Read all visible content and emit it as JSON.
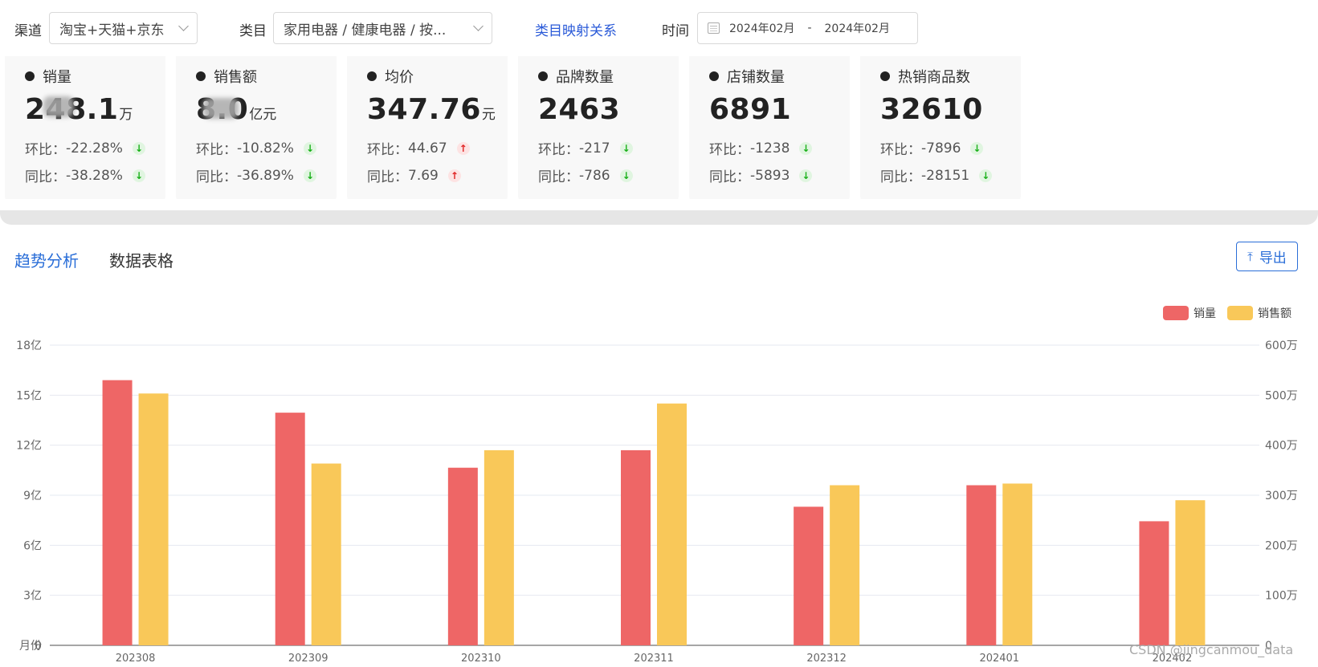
{
  "filters": {
    "channel_label": "渠道",
    "channel_value": "淘宝+天猫+京东",
    "category_label": "类目",
    "category_value": "家用电器 / 健康电器 / 按...",
    "mapping_link": "类目映射关系",
    "time_label": "时间",
    "date_start": "2024年02月",
    "date_sep": "-",
    "date_end": "2024年02月"
  },
  "kpis": [
    {
      "title": "销量",
      "value": "248.1",
      "unit": "万",
      "mom_label": "环比：",
      "mom": "-22.28%",
      "mom_dir": "down",
      "yoy_label": "同比：",
      "yoy": "-38.28%",
      "yoy_dir": "down"
    },
    {
      "title": "销售额",
      "value": "8.0",
      "unit": "亿元",
      "mom_label": "环比：",
      "mom": "-10.82%",
      "mom_dir": "down",
      "yoy_label": "同比：",
      "yoy": "-36.89%",
      "yoy_dir": "down"
    },
    {
      "title": "均价",
      "value": "347.76",
      "unit": "元",
      "mom_label": "环比：",
      "mom": "44.67",
      "mom_dir": "up",
      "yoy_label": "同比：",
      "yoy": "7.69",
      "yoy_dir": "up"
    },
    {
      "title": "品牌数量",
      "value": "2463",
      "unit": "",
      "mom_label": "环比：",
      "mom": "-217",
      "mom_dir": "down",
      "yoy_label": "同比：",
      "yoy": "-786",
      "yoy_dir": "down"
    },
    {
      "title": "店铺数量",
      "value": "6891",
      "unit": "",
      "mom_label": "环比：",
      "mom": "-1238",
      "mom_dir": "down",
      "yoy_label": "同比：",
      "yoy": "-5893",
      "yoy_dir": "down"
    },
    {
      "title": "热销商品数",
      "value": "32610",
      "unit": "",
      "mom_label": "环比：",
      "mom": "-7896",
      "mom_dir": "down",
      "yoy_label": "同比：",
      "yoy": "-28151",
      "yoy_dir": "down"
    }
  ],
  "tabs": {
    "trend": "趋势分析",
    "table": "数据表格"
  },
  "export_label": "导出",
  "watermark": "CSDN @jingcanmou_data",
  "colors": {
    "sales": "#ee6666",
    "revenue": "#f9c859",
    "accent": "#2a6ed8",
    "down": "#19b019",
    "up": "#e02424"
  },
  "chart_data": {
    "type": "bar",
    "categories": [
      "202308",
      "202309",
      "202310",
      "202311",
      "202312",
      "202401",
      "202402"
    ],
    "series": [
      {
        "name": "销量",
        "axis": "right",
        "values": [
          5300000,
          4650000,
          3550000,
          3900000,
          2770000,
          3200000,
          2480000
        ]
      },
      {
        "name": "销售额",
        "axis": "left",
        "values": [
          1510000000,
          1090000000,
          1170000000,
          1450000000,
          960000000,
          970000000,
          870000000
        ]
      }
    ],
    "left_axis": {
      "min": 0,
      "max": 1800000000,
      "ticks": [
        "0",
        "3亿",
        "6亿",
        "9亿",
        "12亿",
        "15亿",
        "18亿"
      ]
    },
    "right_axis": {
      "min": 0,
      "max": 6000000,
      "ticks": [
        "0",
        "100万",
        "200万",
        "300万",
        "400万",
        "500万",
        "600万"
      ]
    },
    "left_axis_extra_label": "月份",
    "legend_position": "top-right",
    "grid": true
  }
}
